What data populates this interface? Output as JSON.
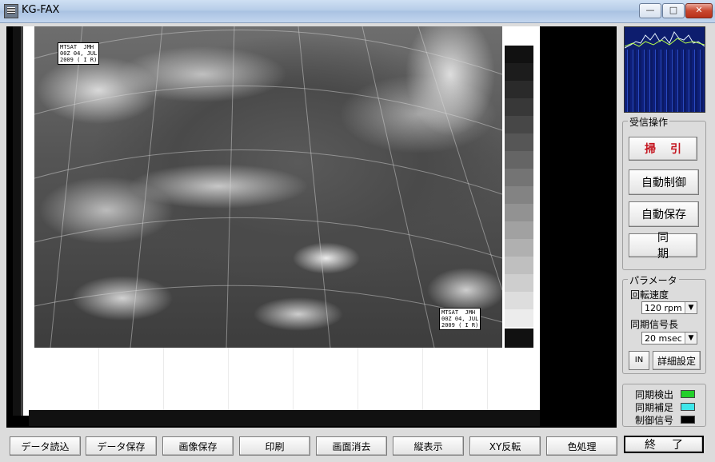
{
  "window": {
    "title": "KG-FAX",
    "min": "—",
    "max": "□",
    "close": "✕"
  },
  "fax": {
    "label_top": "MTSAT  JMH\n00Z 04, JUL\n2009 ( I R)",
    "label_bottom": "MTSAT  JMH\n00Z 04, JUL\n2009 ( I R)"
  },
  "reception": {
    "title": "受信操作",
    "sweep": "掃引",
    "auto_control": "自動制御",
    "auto_save": "自動保存",
    "sync": "同期"
  },
  "parameters": {
    "title": "パラメータ",
    "rotation_label": "回転速度",
    "rotation_value": "120 rpm",
    "sync_len_label": "同期信号長",
    "sync_len_value": "20 msec",
    "detail_button": "詳細設定",
    "icon_button": "IN"
  },
  "status": {
    "sync_detect": "同期検出",
    "sync_correct": "同期補足",
    "control_signal": "制御信号",
    "colors": {
      "sync_detect": "#22d02a",
      "sync_correct": "#3fe6ea",
      "control_signal": "#000000"
    }
  },
  "toolbar": {
    "load": "データ読込",
    "save_data": "データ保存",
    "save_image": "画像保存",
    "print": "印刷",
    "clear": "画面消去",
    "vertical": "縦表示",
    "xy_flip": "XY反転",
    "color": "色処理",
    "exit": "終了"
  }
}
